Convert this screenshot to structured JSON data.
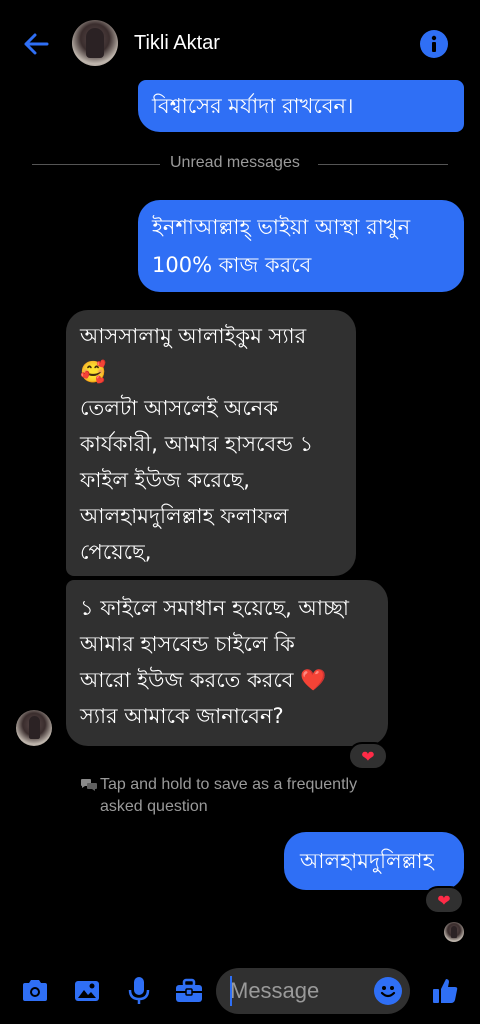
{
  "header": {
    "contact_name": "Tikli Aktar"
  },
  "messages": {
    "m1": "বিশ্বাসের মর্যাদা রাখবেন।",
    "m2_line1": "ইনশাআল্লাহ্ ভাইয়া আস্থা রাখুন",
    "m2_line2": "100% কাজ করবে",
    "m3_line1": "আসসালামু আলাইকুম স্যার",
    "m3_emoji": "🥰",
    "m3_line3": "তেলটা আসলেই অনেক",
    "m3_line4": "কার্যকারী, আমার হাসবেন্ড ১",
    "m3_line5": "ফাইল ইউজ করেছে,",
    "m3_line6": "আলহামদুলিল্লাহ ফলাফল",
    "m3_line7": "পেয়েছে,",
    "m4_line1": "১ ফাইলে সমাধান হয়েছে, আচ্ছা",
    "m4_line2": "আমার হাসবেন্ড চাইলে কি",
    "m4_line3": "আরো ইউজ করতে করবে ❤️",
    "m4_line4": "স্যার আমাকে জানাবেন?",
    "m5": "আলহামদুলিল্লাহ"
  },
  "separator": {
    "label": "Unread messages"
  },
  "tip": {
    "text": "Tap and hold to save as a frequently asked question"
  },
  "reactions": {
    "heart": "❤"
  },
  "composer": {
    "placeholder": "Message"
  },
  "colors": {
    "accent": "#2f6ff5",
    "incoming_bubble": "#303030",
    "background": "#000000"
  },
  "icons": [
    "back-arrow-icon",
    "info-icon",
    "camera-icon",
    "image-icon",
    "microphone-icon",
    "toolbox-icon",
    "emoji-icon",
    "thumbs-up-icon"
  ]
}
